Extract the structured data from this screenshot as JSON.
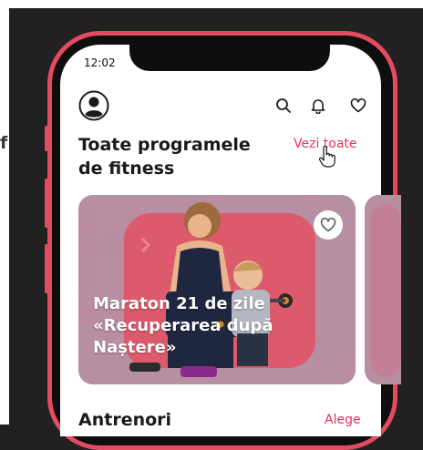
{
  "status_bar": {
    "time": "12:02"
  },
  "header": {
    "avatar_icon": "user-avatar-icon",
    "icons": [
      "search-icon",
      "bell-icon",
      "heart-icon"
    ]
  },
  "programs": {
    "title": "Toate programele de fitness",
    "see_all": "Vezi toate"
  },
  "featured_card": {
    "title": "Maraton 21 de zile «Recuperarea după Naștere»",
    "favorite_icon": "heart-outline-icon"
  },
  "trainers": {
    "title": "Antrenori",
    "action": "Alege"
  },
  "background_fragment": {
    "text": "f"
  },
  "colors": {
    "accent": "#e54b60",
    "link": "#e8315f",
    "card_bg": "#b88ea2"
  }
}
